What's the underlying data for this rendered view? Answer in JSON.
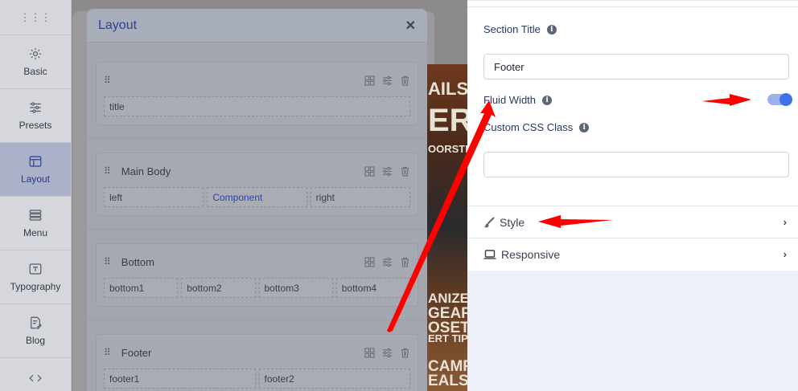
{
  "sidebar": {
    "items": [
      {
        "label": "Basic",
        "icon": "gear-icon"
      },
      {
        "label": "Presets",
        "icon": "sliders-icon"
      },
      {
        "label": "Layout",
        "icon": "layout-icon",
        "active": true
      },
      {
        "label": "Menu",
        "icon": "menu-icon"
      },
      {
        "label": "Typography",
        "icon": "typography-icon"
      },
      {
        "label": "Blog",
        "icon": "blog-icon"
      }
    ]
  },
  "photo": {
    "lines": [
      "AILS",
      "ER",
      "OORSTE",
      "ANIZE",
      "GEAR",
      "OSET",
      "ERT TIPS",
      "CAMP",
      "EALS"
    ]
  },
  "layout_modal": {
    "title": "Layout",
    "sections": [
      {
        "name": "",
        "columns": [
          "title"
        ]
      },
      {
        "name": "Main Body",
        "columns": [
          "left",
          "Component",
          "right"
        ]
      },
      {
        "name": "Bottom",
        "columns": [
          "bottom1",
          "bottom2",
          "bottom3",
          "bottom4"
        ]
      },
      {
        "name": "Footer",
        "columns": [
          "footer1",
          "footer2"
        ]
      }
    ]
  },
  "settings": {
    "section_title_label": "Section Title",
    "section_title_value": "Footer",
    "fluid_width_label": "Fluid Width",
    "fluid_width_on": true,
    "custom_css_label": "Custom CSS Class",
    "custom_css_value": "",
    "style_label": "Style",
    "responsive_label": "Responsive"
  },
  "colors": {
    "accent": "#3f71e8",
    "annotation_arrow": "#ff0000"
  }
}
